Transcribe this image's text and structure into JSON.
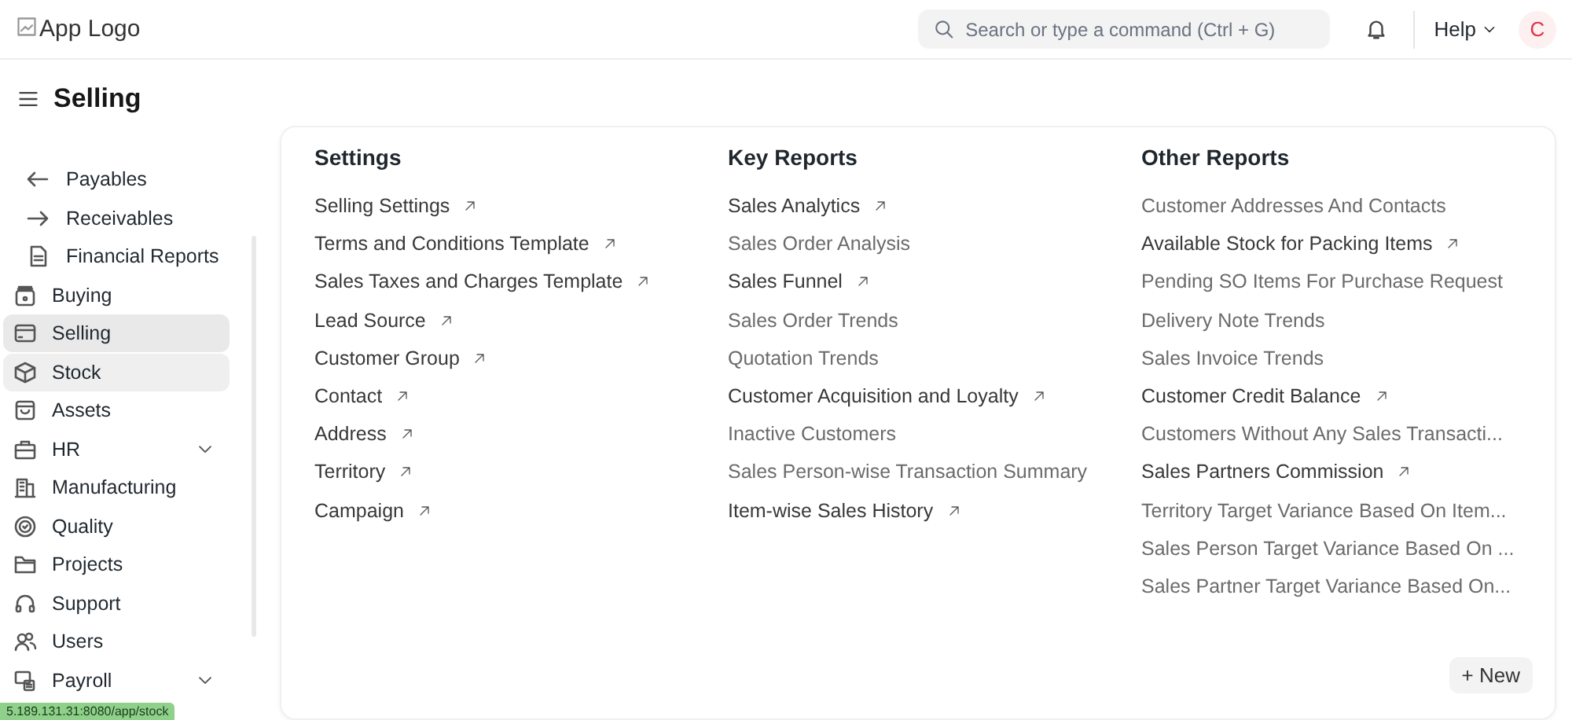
{
  "navbar": {
    "logo_alt": "App Logo",
    "search": {
      "placeholder": "Search or type a command (Ctrl + G)"
    },
    "help": "Help",
    "avatar": "C"
  },
  "page": {
    "title": "Selling"
  },
  "sidebar": {
    "items": [
      {
        "label": "Payables",
        "kind": "sub",
        "selected": false,
        "hovered": false
      },
      {
        "label": "Receivables",
        "kind": "sub",
        "selected": false,
        "hovered": false
      },
      {
        "label": "Financial Reports",
        "kind": "sub",
        "selected": false,
        "hovered": false
      },
      {
        "label": "Buying",
        "kind": "module",
        "selected": false,
        "hovered": false
      },
      {
        "label": "Selling",
        "kind": "module",
        "selected": true,
        "hovered": false
      },
      {
        "label": "Stock",
        "kind": "module",
        "selected": false,
        "hovered": true
      },
      {
        "label": "Assets",
        "kind": "module",
        "selected": false,
        "hovered": false
      },
      {
        "label": "HR",
        "kind": "module",
        "selected": false,
        "hovered": false,
        "expandable": true
      },
      {
        "label": "Manufacturing",
        "kind": "module",
        "selected": false,
        "hovered": false
      },
      {
        "label": "Quality",
        "kind": "module",
        "selected": false,
        "hovered": false
      },
      {
        "label": "Projects",
        "kind": "module",
        "selected": false,
        "hovered": false
      },
      {
        "label": "Support",
        "kind": "module",
        "selected": false,
        "hovered": false
      },
      {
        "label": "Users",
        "kind": "module",
        "selected": false,
        "hovered": false
      },
      {
        "label": "Payroll",
        "kind": "module",
        "selected": false,
        "hovered": false,
        "expandable": true
      }
    ]
  },
  "sections": [
    {
      "title": "Settings",
      "links": [
        {
          "label": "Selling Settings",
          "external": true
        },
        {
          "label": "Terms and Conditions Template",
          "external": true
        },
        {
          "label": "Sales Taxes and Charges Template",
          "external": true
        },
        {
          "label": "Lead Source",
          "external": true
        },
        {
          "label": "Customer Group",
          "external": true
        },
        {
          "label": "Contact",
          "external": true
        },
        {
          "label": "Address",
          "external": true
        },
        {
          "label": "Territory",
          "external": true
        },
        {
          "label": "Campaign",
          "external": true
        }
      ]
    },
    {
      "title": "Key Reports",
      "links": [
        {
          "label": "Sales Analytics",
          "external": true
        },
        {
          "label": "Sales Order Analysis",
          "external": false
        },
        {
          "label": "Sales Funnel",
          "external": true
        },
        {
          "label": "Sales Order Trends",
          "external": false
        },
        {
          "label": "Quotation Trends",
          "external": false
        },
        {
          "label": "Customer Acquisition and Loyalty",
          "external": true
        },
        {
          "label": "Inactive Customers",
          "external": false
        },
        {
          "label": "Sales Person-wise Transaction Summary",
          "external": false
        },
        {
          "label": "Item-wise Sales History",
          "external": true
        }
      ]
    },
    {
      "title": "Other Reports",
      "links": [
        {
          "label": "Customer Addresses And Contacts",
          "external": false
        },
        {
          "label": "Available Stock for Packing Items",
          "external": true
        },
        {
          "label": "Pending SO Items For Purchase Request",
          "external": false
        },
        {
          "label": "Delivery Note Trends",
          "external": false
        },
        {
          "label": "Sales Invoice Trends",
          "external": false
        },
        {
          "label": "Customer Credit Balance",
          "external": true
        },
        {
          "label": "Customers Without Any Sales Transacti...",
          "external": false
        },
        {
          "label": "Sales Partners Commission",
          "external": true
        },
        {
          "label": "Territory Target Variance Based On Item...",
          "external": false
        },
        {
          "label": "Sales Person Target Variance Based On ...",
          "external": false
        },
        {
          "label": "Sales Partner Target Variance Based On...",
          "external": false
        }
      ]
    }
  ],
  "new_button": "+ New",
  "status_url": "5.189.131.31:8080/app/stock"
}
